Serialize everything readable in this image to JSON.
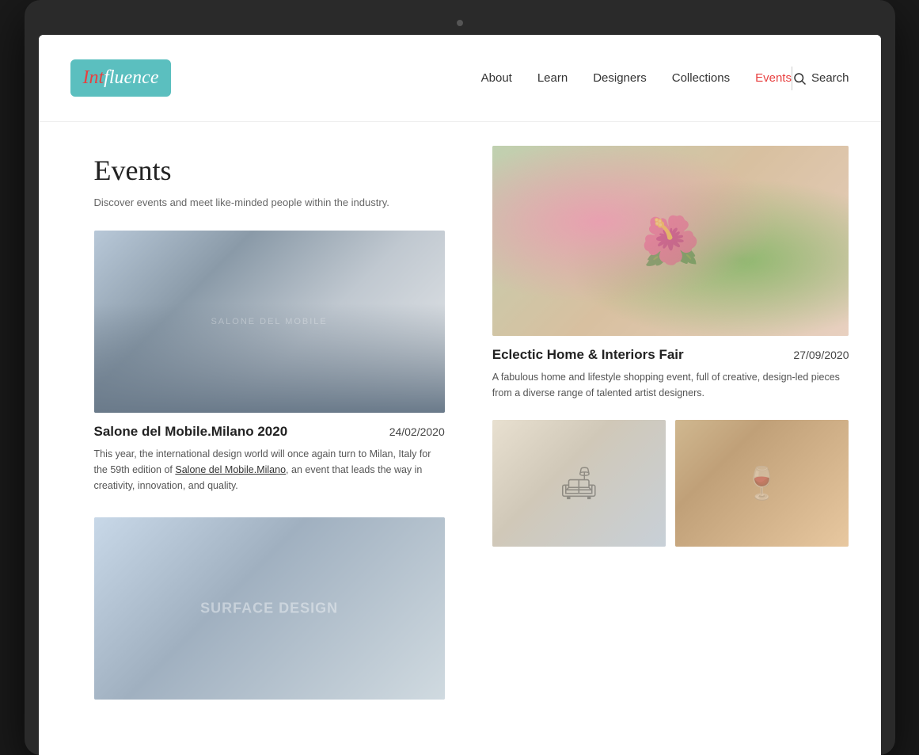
{
  "laptop": {
    "screen_bg": "#ffffff"
  },
  "navbar": {
    "logo_int": "Int",
    "logo_fluence": "fluence",
    "links": [
      {
        "id": "about",
        "label": "About",
        "active": false
      },
      {
        "id": "learn",
        "label": "Learn",
        "active": false
      },
      {
        "id": "designers",
        "label": "Designers",
        "active": false
      },
      {
        "id": "collections",
        "label": "Collections",
        "active": false
      },
      {
        "id": "events",
        "label": "Events",
        "active": true
      }
    ],
    "search_label": "Search"
  },
  "page": {
    "title": "Events",
    "subtitle": "Discover events and meet like-minded people within the industry."
  },
  "events_left": [
    {
      "id": "salone",
      "title": "Salone del Mobile.Milano 2020",
      "date": "24/02/2020",
      "description": "This year, the international design world will once again turn to Milan, Italy for the 59th edition of",
      "link_text": "Salone del Mobile.Milano",
      "description_end": ", an event that leads the way in creativity, innovation, and quality.",
      "image_type": "milan"
    }
  ],
  "events_right": [
    {
      "id": "eclectic",
      "title": "Eclectic Home & Interiors Fair",
      "date": "27/09/2020",
      "description": "A fabulous home and lifestyle shopping event, full of creative, design-led pieces from a diverse range of talented artist designers.",
      "image_type": "eclectic"
    }
  ],
  "bottom_images": [
    {
      "id": "interior",
      "image_type": "interior"
    },
    {
      "id": "restaurant",
      "image_type": "restaurant"
    }
  ]
}
